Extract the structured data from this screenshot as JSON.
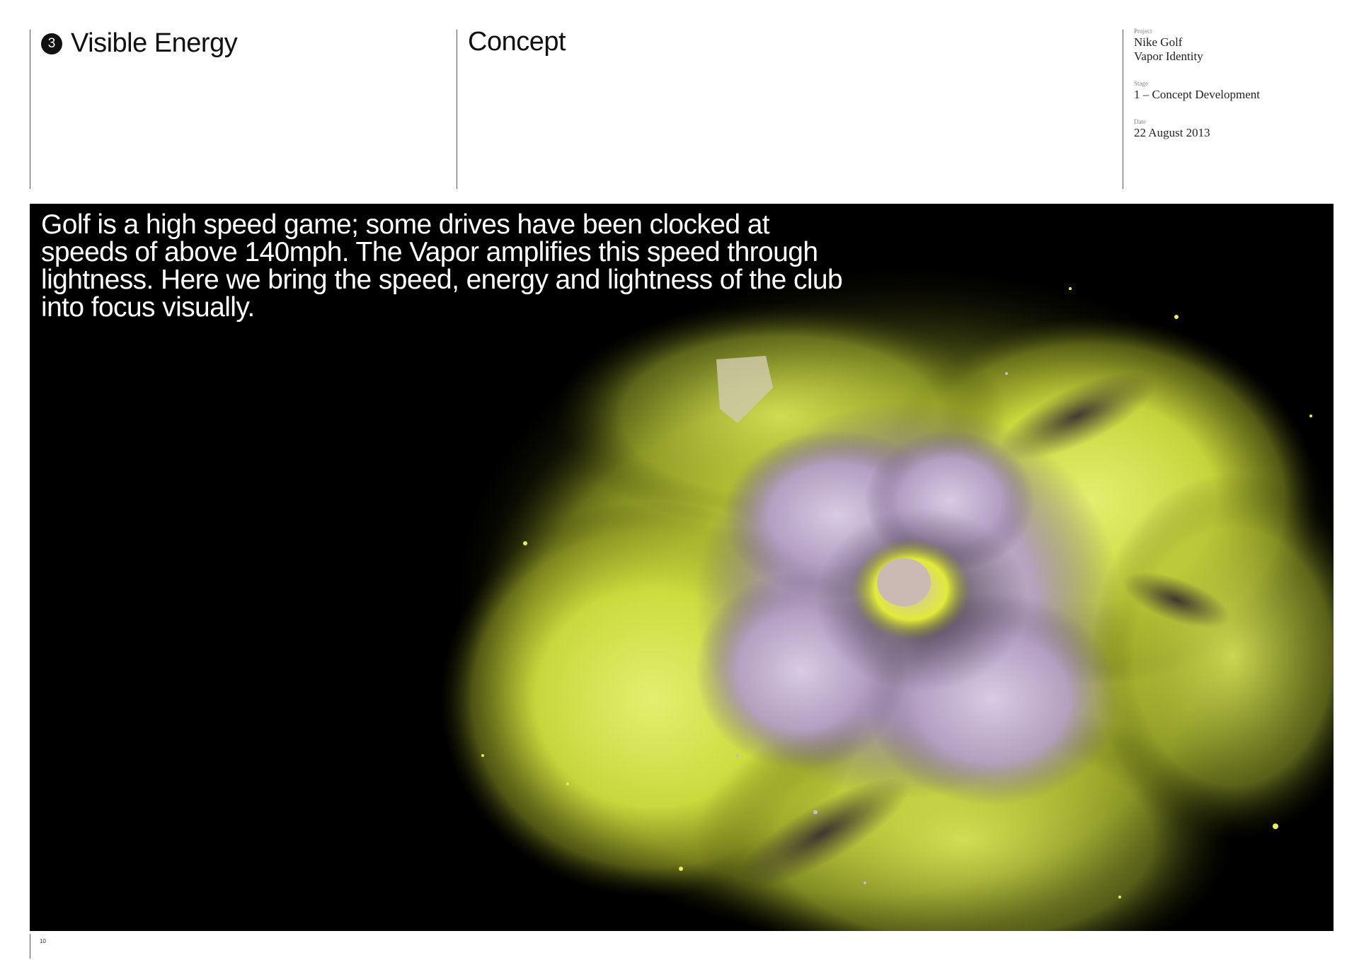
{
  "header": {
    "section_number": "3",
    "section_title": "Visible Energy",
    "column_title": "Concept"
  },
  "meta": {
    "project_label": "Project",
    "project_line1": "Nike Golf",
    "project_line2": "Vapor Identity",
    "stage_label": "Stage",
    "stage_value": "1 – Concept Development",
    "date_label": "Date",
    "date_value": "22 August 2013"
  },
  "hero": {
    "description": "Golf is a high speed game; some drives have been clocked at speeds of above 140mph. The Vapor amplifies this speed through lightness. Here we bring the speed, energy and lightness of the club into focus visually.",
    "colors": {
      "background": "#000000",
      "dust_yellow": "#d4e44a",
      "dust_lilac": "#b8a4c8"
    }
  },
  "footer": {
    "page_number": "10"
  }
}
